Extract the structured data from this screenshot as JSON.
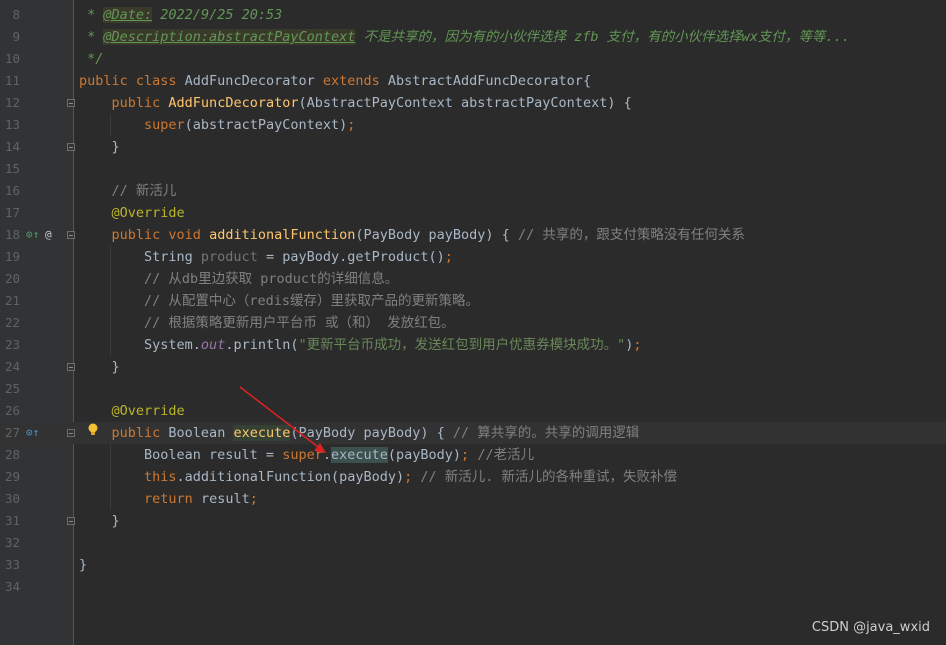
{
  "lines": [
    {
      "num": "8",
      "segs": [
        {
          "c": "doc",
          "t": " * "
        },
        {
          "c": "doctag",
          "t": "@Date:"
        },
        {
          "c": "doc",
          "t": " 2022/9/25 20:53"
        }
      ],
      "indent": 0
    },
    {
      "num": "9",
      "segs": [
        {
          "c": "doc",
          "t": " * "
        },
        {
          "c": "doctag",
          "t": "@Description:abstractPayContext"
        },
        {
          "c": "doc",
          "t": " 不是共享的，因为有的小伙伴选择 zfb 支付，有的小伙伴选择wx支付，等等..."
        }
      ],
      "indent": 0
    },
    {
      "num": "10",
      "segs": [
        {
          "c": "doc",
          "t": " */"
        }
      ],
      "indent": 0
    },
    {
      "num": "11",
      "segs": [
        {
          "c": "kw",
          "t": "public class "
        },
        {
          "c": "",
          "t": "AddFuncDecorator "
        },
        {
          "c": "kw",
          "t": "extends "
        },
        {
          "c": "",
          "t": "AbstractAddFuncDecorator{"
        }
      ],
      "indent": 0
    },
    {
      "num": "12",
      "segs": [
        {
          "c": "",
          "t": "    "
        },
        {
          "c": "kw",
          "t": "public "
        },
        {
          "c": "fn",
          "t": "AddFuncDecorator"
        },
        {
          "c": "",
          "t": "(AbstractPayContext abstractPayContext) {"
        }
      ],
      "indent": 0
    },
    {
      "num": "13",
      "segs": [
        {
          "c": "",
          "t": "        "
        },
        {
          "c": "kw",
          "t": "super"
        },
        {
          "c": "",
          "t": "(abstractPayContext)"
        },
        {
          "c": "kw",
          "t": ";"
        }
      ],
      "indent": 0
    },
    {
      "num": "14",
      "segs": [
        {
          "c": "",
          "t": "    }"
        }
      ],
      "indent": 0
    },
    {
      "num": "15",
      "segs": [
        {
          "c": "",
          "t": ""
        }
      ],
      "indent": 0
    },
    {
      "num": "16",
      "segs": [
        {
          "c": "",
          "t": "    "
        },
        {
          "c": "com",
          "t": "// 新活儿"
        }
      ],
      "indent": 0
    },
    {
      "num": "17",
      "segs": [
        {
          "c": "",
          "t": "    "
        },
        {
          "c": "ann",
          "t": "@Override"
        }
      ],
      "indent": 0
    },
    {
      "num": "18",
      "segs": [
        {
          "c": "",
          "t": "    "
        },
        {
          "c": "kw",
          "t": "public void "
        },
        {
          "c": "fn",
          "t": "additionalFunction"
        },
        {
          "c": "",
          "t": "(PayBody payBody) { "
        },
        {
          "c": "com",
          "t": "// 共享的，跟支付策略没有任何关系"
        }
      ],
      "indent": 0
    },
    {
      "num": "19",
      "segs": [
        {
          "c": "",
          "t": "        String "
        },
        {
          "c": "unused",
          "t": "product"
        },
        {
          "c": "",
          "t": " = payBody.getProduct()"
        },
        {
          "c": "kw",
          "t": ";"
        }
      ],
      "indent": 0
    },
    {
      "num": "20",
      "segs": [
        {
          "c": "",
          "t": "        "
        },
        {
          "c": "com",
          "t": "// 从db里边获取 product的详细信息。"
        }
      ],
      "indent": 0
    },
    {
      "num": "21",
      "segs": [
        {
          "c": "",
          "t": "        "
        },
        {
          "c": "com",
          "t": "// 从配置中心（redis缓存）里获取产品的更新策略。"
        }
      ],
      "indent": 0
    },
    {
      "num": "22",
      "segs": [
        {
          "c": "",
          "t": "        "
        },
        {
          "c": "com",
          "t": "// 根据策略更新用户平台币 或（和） 发放红包。"
        }
      ],
      "indent": 0
    },
    {
      "num": "23",
      "segs": [
        {
          "c": "",
          "t": "        System."
        },
        {
          "c": "static",
          "t": "out"
        },
        {
          "c": "",
          "t": ".println("
        },
        {
          "c": "str",
          "t": "\"更新平台币成功，发送红包到用户优惠券模块成功。\""
        },
        {
          "c": "",
          "t": ")"
        },
        {
          "c": "kw",
          "t": ";"
        }
      ],
      "indent": 0
    },
    {
      "num": "24",
      "segs": [
        {
          "c": "",
          "t": "    }"
        }
      ],
      "indent": 0
    },
    {
      "num": "25",
      "segs": [
        {
          "c": "",
          "t": ""
        }
      ],
      "indent": 0
    },
    {
      "num": "26",
      "segs": [
        {
          "c": "",
          "t": "    "
        },
        {
          "c": "ann",
          "t": "@Override"
        }
      ],
      "indent": 0
    },
    {
      "num": "27",
      "segs": [
        {
          "c": "",
          "t": "    "
        },
        {
          "c": "kw",
          "t": "public "
        },
        {
          "c": "",
          "t": "Boolean "
        },
        {
          "c": "fn hl",
          "t": "execute"
        },
        {
          "c": "",
          "t": "(PayBody payBody) { "
        },
        {
          "c": "com",
          "t": "// 算共享的。共享的调用逻辑"
        }
      ],
      "indent": 0,
      "current": true
    },
    {
      "num": "28",
      "segs": [
        {
          "c": "",
          "t": "        Boolean result = "
        },
        {
          "c": "kw",
          "t": "super"
        },
        {
          "c": "",
          "t": "."
        },
        {
          "c": "hl2",
          "t": "execute"
        },
        {
          "c": "",
          "t": "(payBody)"
        },
        {
          "c": "kw",
          "t": "; "
        },
        {
          "c": "com",
          "t": "//老活儿"
        }
      ],
      "indent": 0
    },
    {
      "num": "29",
      "segs": [
        {
          "c": "",
          "t": "        "
        },
        {
          "c": "kw",
          "t": "this"
        },
        {
          "c": "",
          "t": ".additionalFunction(payBody)"
        },
        {
          "c": "kw",
          "t": "; "
        },
        {
          "c": "com",
          "t": "// 新活儿. 新活儿的各种重试，失败补偿"
        }
      ],
      "indent": 0
    },
    {
      "num": "30",
      "segs": [
        {
          "c": "",
          "t": "        "
        },
        {
          "c": "kw",
          "t": "return "
        },
        {
          "c": "",
          "t": "result"
        },
        {
          "c": "kw",
          "t": ";"
        }
      ],
      "indent": 0
    },
    {
      "num": "31",
      "segs": [
        {
          "c": "",
          "t": "    }"
        }
      ],
      "indent": 0
    },
    {
      "num": "32",
      "segs": [
        {
          "c": "",
          "t": ""
        }
      ],
      "indent": 0
    },
    {
      "num": "33",
      "segs": [
        {
          "c": "",
          "t": "}"
        }
      ],
      "indent": 0
    },
    {
      "num": "34",
      "segs": [
        {
          "c": "",
          "t": ""
        }
      ],
      "indent": 0
    }
  ],
  "watermark": "CSDN @java_wxid"
}
